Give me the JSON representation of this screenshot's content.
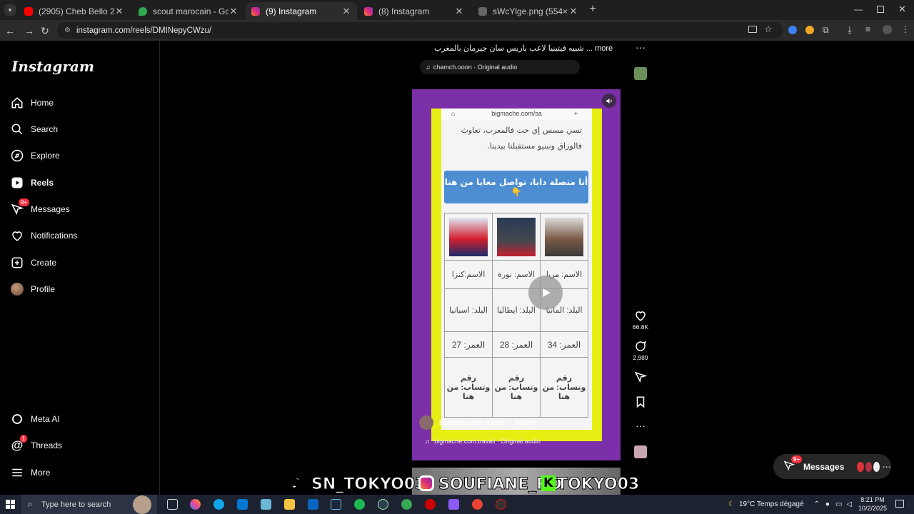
{
  "browser": {
    "tabs": [
      {
        "title": "(2905) Cheb Bello 2025 | Galbi",
        "icon": "youtube-icon",
        "color": "#ff0000"
      },
      {
        "title": "scout marocain - Google Maps",
        "icon": "maps-icon",
        "color": "#34a853"
      },
      {
        "title": "(9) Instagram",
        "icon": "instagram-icon",
        "color": "#e1306c"
      },
      {
        "title": "(8) Instagram",
        "icon": "instagram-icon",
        "color": "#e1306c"
      },
      {
        "title": "sWcYlge.png (554×986)",
        "icon": "image-icon",
        "color": "#888888"
      }
    ],
    "url": "instagram.com/reels/DMINepyCWzu/"
  },
  "instagram": {
    "logo": "Instagram",
    "nav": [
      {
        "label": "Home",
        "icon": "home-icon"
      },
      {
        "label": "Search",
        "icon": "search-icon"
      },
      {
        "label": "Explore",
        "icon": "compass-icon"
      },
      {
        "label": "Reels",
        "icon": "reels-icon"
      },
      {
        "label": "Messages",
        "icon": "messenger-icon",
        "badge": "9+"
      },
      {
        "label": "Notifications",
        "icon": "heart-icon"
      },
      {
        "label": "Create",
        "icon": "plus-square-icon"
      },
      {
        "label": "Profile",
        "icon": "avatar"
      }
    ],
    "bottom_nav": [
      {
        "label": "Meta AI",
        "icon": "meta-ai-icon"
      },
      {
        "label": "Threads",
        "icon": "threads-icon",
        "badge": "1"
      },
      {
        "label": "More",
        "icon": "menu-icon"
      }
    ]
  },
  "reel": {
    "caption": "شبيه فيتينيا لاعب باريس سان جيرمان بالمغرب ... more",
    "audio_top": "chamch.ooon · Original audio",
    "phone_url": "bigmache.com/sa",
    "arabic_text": [
      "تسي مسس إي حت فالمعرب، تعاوث",
      "فالوراق ونبنيو مستقبلنا بيدينا."
    ],
    "cta_button": "أنا متصلة دابا، تواصل معايا من هنا 👇",
    "table": {
      "names": [
        "الاسم:كنزا",
        "الاسم: نورة",
        "الاسم: مريا"
      ],
      "countries": [
        "البلد: اسبانيا",
        "البلد: ايطاليا",
        "البلد: المانيا"
      ],
      "ages": [
        "العمر: 27",
        "العمر: 28",
        "العمر: 34"
      ],
      "whatsapp": [
        "رقم وتساب: من هنا",
        "رقم وتساب: من هنا",
        "رقم وتساب: من هنا"
      ]
    },
    "author": "bigmache.com.travail",
    "follow": "Follow",
    "audio_bottom": "bigmache.com.travail · Original audio",
    "likes": "66.8K",
    "comments": "2,989"
  },
  "watermark": {
    "tiktok": "SN_TOKYO03",
    "instagram": "SOUFIANE_RO",
    "kick": "TOKYO03"
  },
  "messages_pill": {
    "label": "Messages",
    "badge": "9+"
  },
  "taskbar": {
    "search_placeholder": "Type here to search",
    "weather": "19°C  Temps dégagé",
    "time": "8:21 PM",
    "date": "10/2/2025"
  }
}
